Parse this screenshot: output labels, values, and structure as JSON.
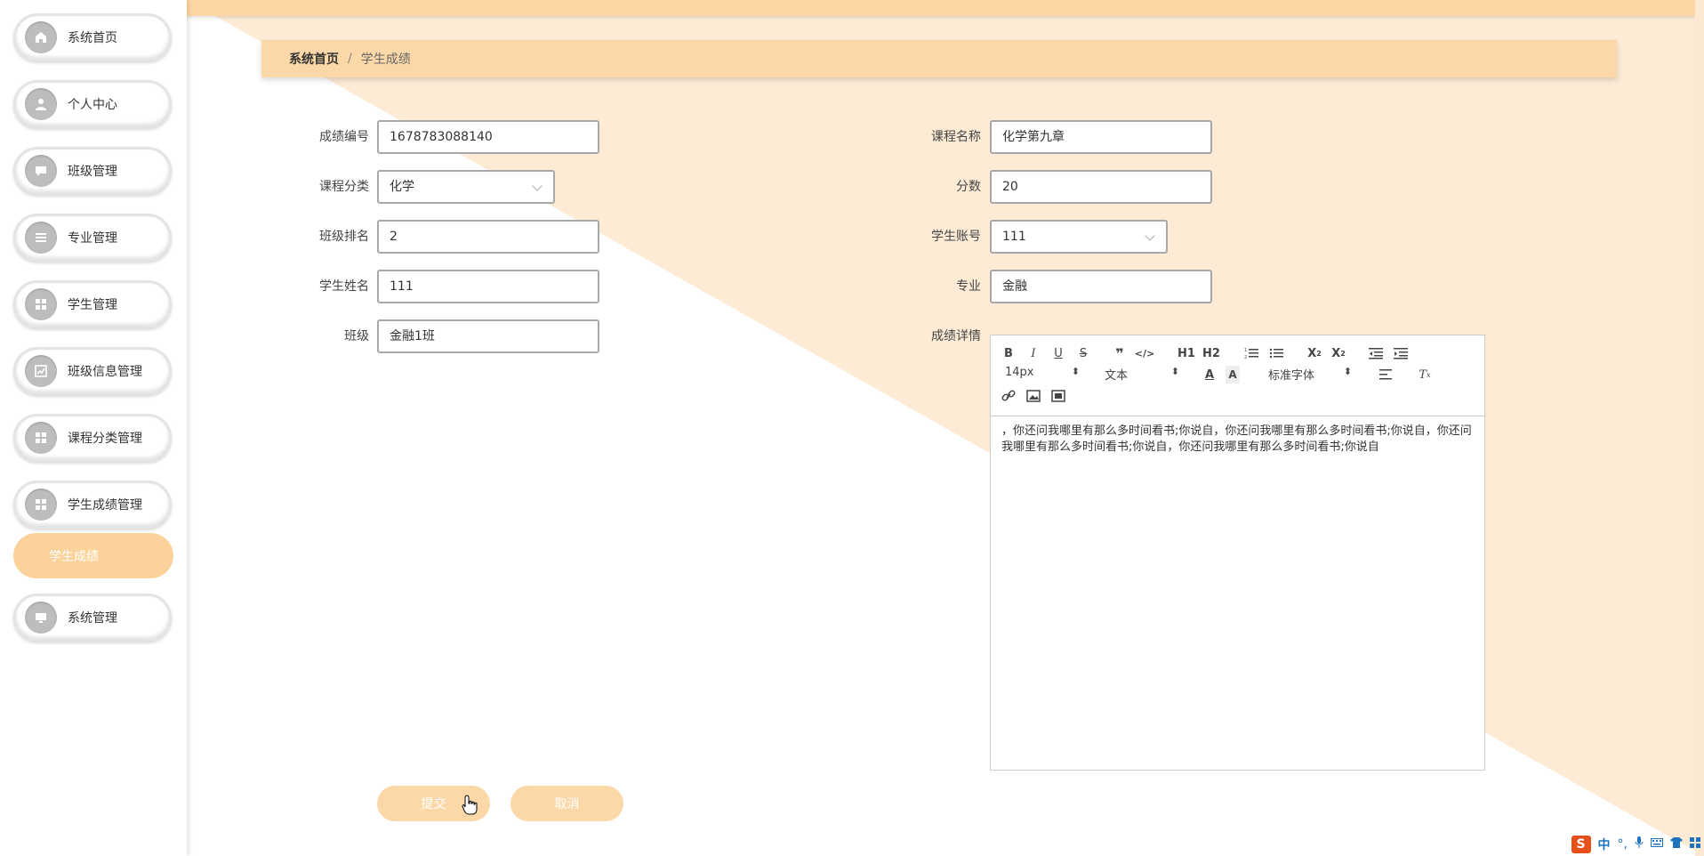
{
  "sidebar": {
    "items": [
      {
        "label": "系统首页",
        "icon": "home-icon"
      },
      {
        "label": "个人中心",
        "icon": "user-icon"
      },
      {
        "label": "班级管理",
        "icon": "chat-icon"
      },
      {
        "label": "专业管理",
        "icon": "list-icon"
      },
      {
        "label": "学生管理",
        "icon": "grid-icon"
      },
      {
        "label": "班级信息管理",
        "icon": "chart-icon"
      },
      {
        "label": "课程分类管理",
        "icon": "grid-icon"
      },
      {
        "label": "学生成绩管理",
        "icon": "grid-icon"
      },
      {
        "label": "系统管理",
        "icon": "monitor-icon"
      }
    ],
    "active_sub": "学生成绩"
  },
  "breadcrumb": {
    "home": "系统首页",
    "separator": "/",
    "current": "学生成绩"
  },
  "form": {
    "score_id": {
      "label": "成绩编号",
      "value": "1678783088140"
    },
    "course_name": {
      "label": "课程名称",
      "value": "化学第九章"
    },
    "course_category": {
      "label": "课程分类",
      "value": "化学"
    },
    "score": {
      "label": "分数",
      "value": "20"
    },
    "class_rank": {
      "label": "班级排名",
      "value": "2"
    },
    "student_account": {
      "label": "学生账号",
      "value": "111"
    },
    "student_name": {
      "label": "学生姓名",
      "value": "111"
    },
    "major": {
      "label": "专业",
      "value": "金融"
    },
    "class": {
      "label": "班级",
      "value": "金融1班"
    },
    "details": {
      "label": "成绩详情",
      "content": "，你还问我哪里有那么多时间看书;你说自，你还问我哪里有那么多时间看书;你说自，你还问我哪里有那么多时间看书;你说自，你还问我哪里有那么多时间看书;你说自"
    }
  },
  "editor": {
    "font_size": "14px",
    "block_format": "文本",
    "font_family": "标准字体",
    "h1": "H1",
    "h2": "H2"
  },
  "buttons": {
    "submit": "提交",
    "cancel": "取消"
  },
  "tray": {
    "ime_lang": "中"
  },
  "colors": {
    "accent": "#fcd8a8",
    "sub_active": "#fbd39a",
    "bg_triangle": "#fdebd6"
  }
}
